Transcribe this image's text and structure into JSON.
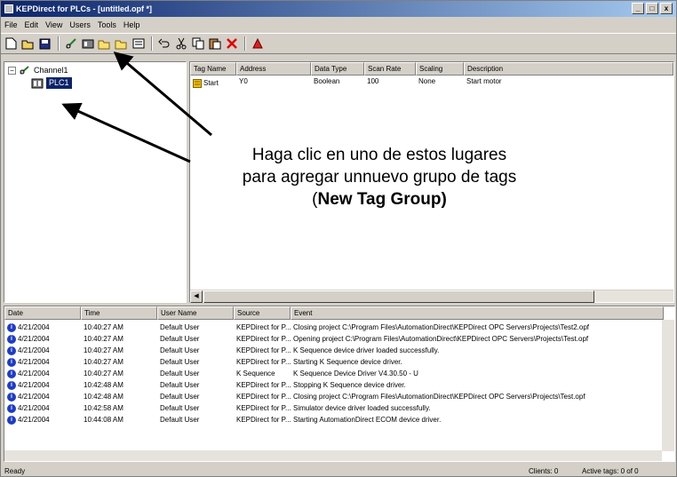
{
  "window": {
    "title": "KEPDirect for PLCs - [untitled.opf *]",
    "controls": [
      "_",
      "□",
      "x"
    ]
  },
  "menu": [
    "File",
    "Edit",
    "View",
    "Users",
    "Tools",
    "Help"
  ],
  "tree": {
    "root_label": "Channel1",
    "child_label": "PLC1"
  },
  "tags": {
    "columns": [
      "Tag Name",
      "Address",
      "Data Type",
      "Scan Rate",
      "Scaling",
      "Description"
    ],
    "rows": [
      [
        "Start",
        "Y0",
        "Boolean",
        "100",
        "None",
        "Start motor"
      ]
    ]
  },
  "log": {
    "columns": [
      "Date",
      "Time",
      "User Name",
      "Source",
      "Event"
    ],
    "rows": [
      [
        "4/21/2004",
        "10:40:27 AM",
        "Default User",
        "KEPDirect for P...",
        "Closing project C:\\Program Files\\AutomationDirect\\KEPDirect OPC Servers\\Projects\\Test2.opf"
      ],
      [
        "4/21/2004",
        "10:40:27 AM",
        "Default User",
        "KEPDirect for P...",
        "Opening project C:\\Program Files\\AutomationDirect\\KEPDirect OPC Servers\\Projects\\Test.opf"
      ],
      [
        "4/21/2004",
        "10:40:27 AM",
        "Default User",
        "KEPDirect for P...",
        "K Sequence device driver loaded successfully."
      ],
      [
        "4/21/2004",
        "10:40:27 AM",
        "Default User",
        "KEPDirect for P...",
        "Starting K Sequence device driver."
      ],
      [
        "4/21/2004",
        "10:40:27 AM",
        "Default User",
        "K Sequence",
        "K Sequence Device Driver V4.30.50 - U"
      ],
      [
        "4/21/2004",
        "10:42:48 AM",
        "Default User",
        "KEPDirect for P...",
        "Stopping K Sequence device driver."
      ],
      [
        "4/21/2004",
        "10:42:48 AM",
        "Default User",
        "KEPDirect for P...",
        "Closing project C:\\Program Files\\AutomationDirect\\KEPDirect OPC Servers\\Projects\\Test.opf"
      ],
      [
        "4/21/2004",
        "10:42:58 AM",
        "Default User",
        "KEPDirect for P...",
        "Simulator device driver loaded successfully."
      ],
      [
        "4/21/2004",
        "10:44:08 AM",
        "Default User",
        "KEPDirect for P...",
        "Starting AutomationDirect ECOM device driver."
      ]
    ]
  },
  "status": {
    "left": "Ready",
    "clients": "Clients: 0",
    "active_tags": "Active tags: 0 of 0"
  },
  "annotation": {
    "line1": "Haga clic en uno de estos lugares",
    "line2": "para agregar unnuevo grupo de tags",
    "line3_open": "(",
    "line3_bold": "New Tag Group)"
  },
  "colors": {
    "title_start": "#0a246a",
    "title_end": "#a6caf0",
    "selection": "#0a246a",
    "info_icon": "#1e3cc8"
  }
}
